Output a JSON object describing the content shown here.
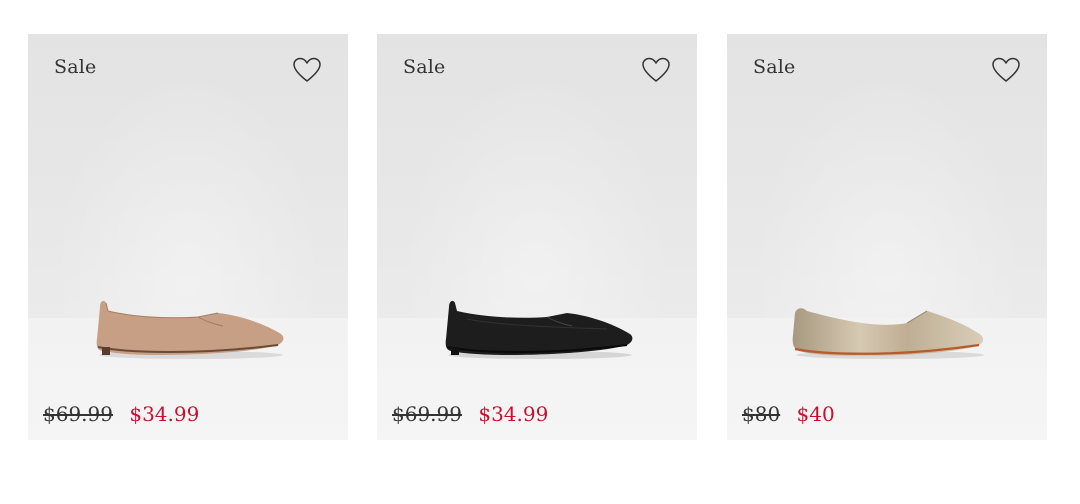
{
  "products": [
    {
      "badge": "Sale",
      "original_price": "$69.99",
      "sale_price": "$34.99",
      "wishlist_icon": "heart-outline-icon",
      "color": "#c69f85"
    },
    {
      "badge": "Sale",
      "original_price": "$69.99",
      "sale_price": "$34.99",
      "wishlist_icon": "heart-outline-icon",
      "color": "#1d1d1d"
    },
    {
      "badge": "Sale",
      "original_price": "$80",
      "sale_price": "$40",
      "wishlist_icon": "heart-outline-icon",
      "color": "#c8b8a0"
    }
  ],
  "colors": {
    "sale_price": "#c8102e",
    "text": "#333333",
    "card_background": "#e6e6e6"
  }
}
